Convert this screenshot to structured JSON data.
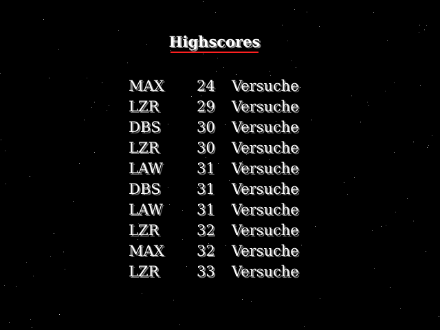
{
  "title": "Highscores",
  "colors": {
    "background": "#000000",
    "text": "#ffffff",
    "shadow": "#7a7a7a",
    "title_underline": "#ff2020"
  },
  "highscores": [
    {
      "name": "MAX",
      "score": "24",
      "unit": "Versuche"
    },
    {
      "name": "LZR",
      "score": "29",
      "unit": "Versuche"
    },
    {
      "name": "DBS",
      "score": "30",
      "unit": "Versuche"
    },
    {
      "name": "LZR",
      "score": "30",
      "unit": "Versuche"
    },
    {
      "name": "LAW",
      "score": "31",
      "unit": "Versuche"
    },
    {
      "name": "DBS",
      "score": "31",
      "unit": "Versuche"
    },
    {
      "name": "LAW",
      "score": "31",
      "unit": "Versuche"
    },
    {
      "name": "LZR",
      "score": "32",
      "unit": "Versuche"
    },
    {
      "name": "MAX",
      "score": "32",
      "unit": "Versuche"
    },
    {
      "name": "LZR",
      "score": "33",
      "unit": "Versuche"
    }
  ]
}
